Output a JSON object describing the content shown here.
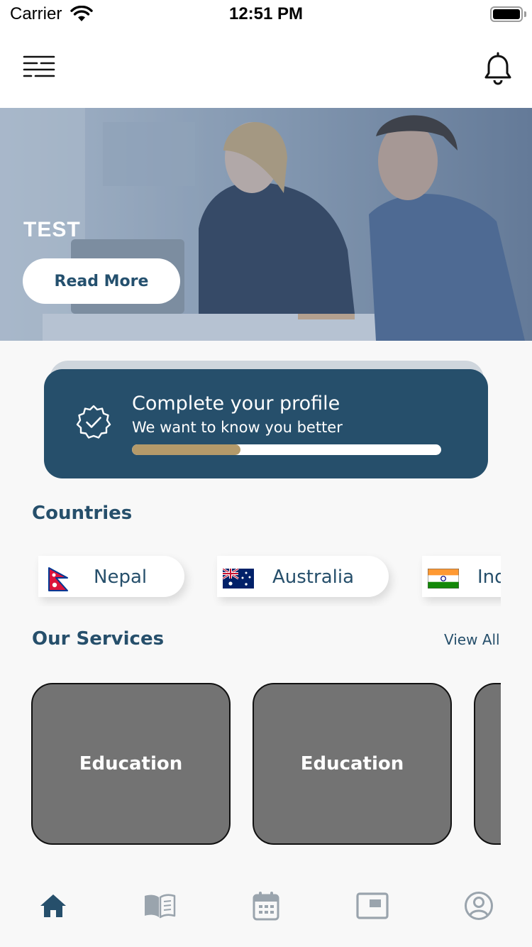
{
  "status_bar": {
    "carrier": "Carrier",
    "time": "12:51 PM"
  },
  "app_bar": {
    "menu_icon": "menu-icon",
    "notification_icon": "bell-icon"
  },
  "hero": {
    "title": "TEST",
    "button_label": "Read More"
  },
  "profile_card": {
    "title": "Complete your profile",
    "subtitle": "We want to know you better",
    "icon": "verified-badge-icon",
    "progress": 0.35,
    "colors": {
      "background": "#264f6b",
      "progress": "#b49a6a"
    }
  },
  "countries": {
    "title": "Countries",
    "items": [
      {
        "name": "Nepal",
        "flag": "nepal-flag-icon"
      },
      {
        "name": "Australia",
        "flag": "australia-flag-icon"
      },
      {
        "name": "India",
        "flag": "india-flag-icon"
      }
    ]
  },
  "services": {
    "title": "Our Services",
    "view_all": "View All",
    "items": [
      {
        "label": "Education"
      },
      {
        "label": "Education"
      },
      {
        "label": ""
      }
    ]
  },
  "bottom_nav": {
    "items": [
      {
        "icon": "home-icon",
        "active": true
      },
      {
        "icon": "book-icon",
        "active": false
      },
      {
        "icon": "calendar-icon",
        "active": false
      },
      {
        "icon": "media-icon",
        "active": false
      },
      {
        "icon": "profile-icon",
        "active": false
      }
    ],
    "colors": {
      "active": "#264f6b",
      "inactive": "#9aa4ad"
    }
  }
}
